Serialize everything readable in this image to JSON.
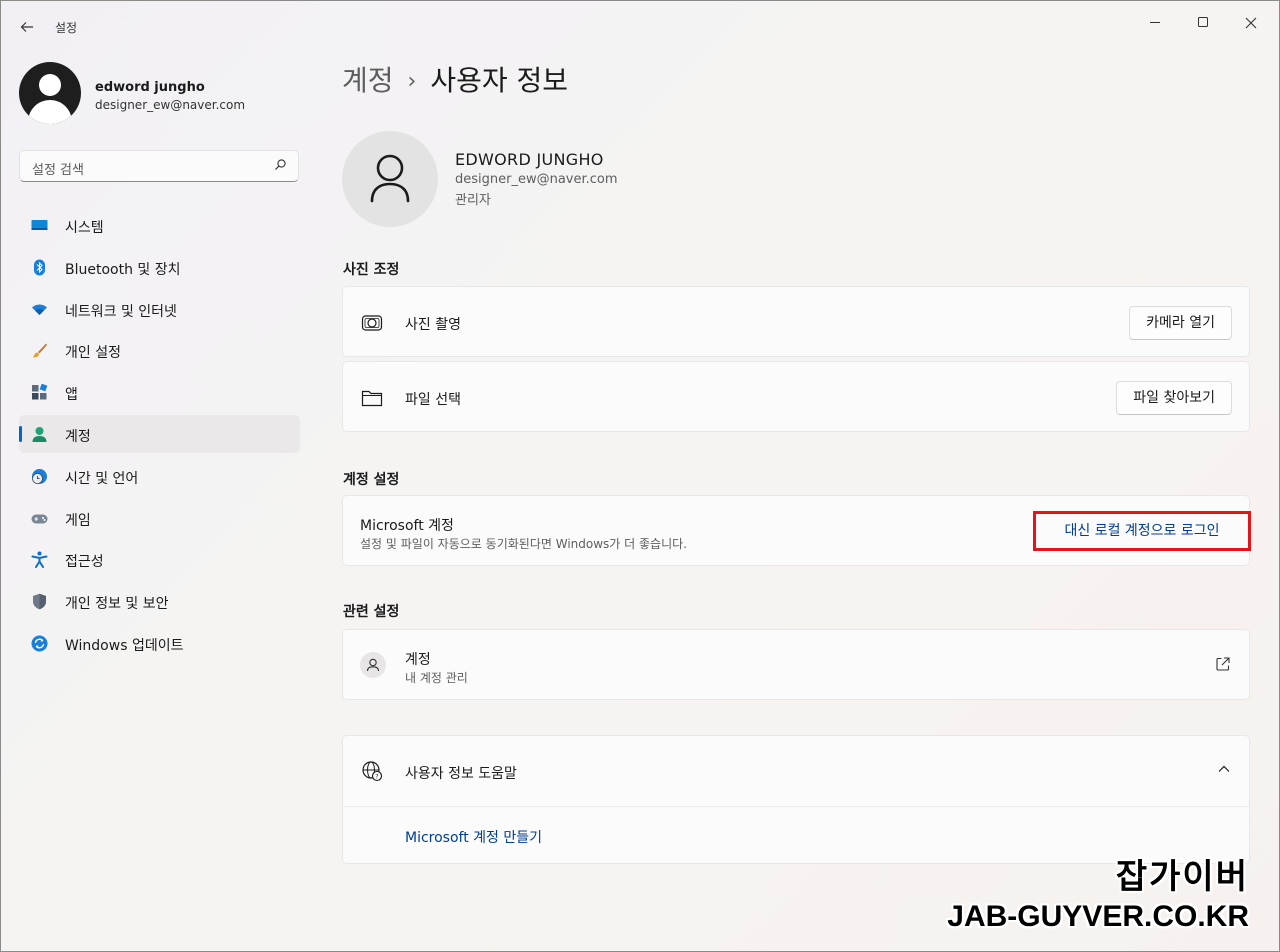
{
  "window": {
    "title": "설정",
    "controls": [
      "minimize-icon",
      "maximize-icon",
      "close-icon"
    ]
  },
  "profile": {
    "name": "edword jungho",
    "email": "designer_ew@naver.com"
  },
  "search": {
    "placeholder": "설정 검색"
  },
  "sidebar": {
    "items": [
      {
        "label": "시스템",
        "icon": "system-icon"
      },
      {
        "label": "Bluetooth 및 장치",
        "icon": "bluetooth-icon"
      },
      {
        "label": "네트워크 및 인터넷",
        "icon": "wifi-icon"
      },
      {
        "label": "개인 설정",
        "icon": "brush-icon"
      },
      {
        "label": "앱",
        "icon": "apps-icon"
      },
      {
        "label": "계정",
        "icon": "account-icon",
        "active": true
      },
      {
        "label": "시간 및 언어",
        "icon": "globe-clock-icon"
      },
      {
        "label": "게임",
        "icon": "gamepad-icon"
      },
      {
        "label": "접근성",
        "icon": "accessibility-icon"
      },
      {
        "label": "개인 정보 및 보안",
        "icon": "shield-icon"
      },
      {
        "label": "Windows 업데이트",
        "icon": "update-icon"
      }
    ]
  },
  "breadcrumb": {
    "parent": "계정",
    "separator": "›",
    "current": "사용자 정보"
  },
  "user": {
    "name": "EDWORD JUNGHO",
    "email": "designer_ew@naver.com",
    "role": "관리자"
  },
  "photo_section": {
    "title": "사진 조정",
    "take_photo_label": "사진 촬영",
    "open_camera_button": "카메라 열기",
    "choose_file_label": "파일 선택",
    "browse_button": "파일 찾아보기"
  },
  "account_section": {
    "title": "계정 설정",
    "ms_account_title": "Microsoft 계정",
    "ms_account_desc": "설정 및 파일이 자동으로 동기화된다면 Windows가 더 좋습니다.",
    "local_signin_link": "대신 로컬 계정으로 로그인"
  },
  "related_section": {
    "title": "관련 설정",
    "accounts_title": "계정",
    "accounts_sub": "내 계정 관리"
  },
  "help_section": {
    "title": "사용자 정보 도움말",
    "link": "Microsoft 계정 만들기"
  },
  "watermark": {
    "korean": "잡가이버",
    "domain": "JAB-GUYVER.CO.KR"
  },
  "colors": {
    "accent": "#0067c0",
    "link": "#003e92",
    "highlight_border": "#e4141b"
  }
}
